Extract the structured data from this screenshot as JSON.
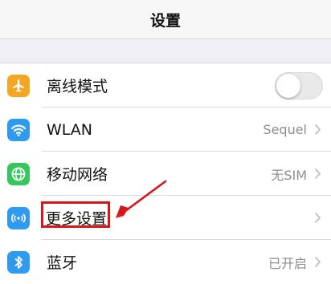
{
  "header": {
    "title": "设置"
  },
  "settings": {
    "airplane": {
      "label": "离线模式",
      "icon": "airplane-icon",
      "color": "#f5a623",
      "toggle": "off"
    },
    "wlan": {
      "label": "WLAN",
      "value": "Sequel",
      "icon": "wifi-icon",
      "color": "#2f9bf0"
    },
    "cellular": {
      "label": "移动网络",
      "value": "无SIM",
      "icon": "globe-icon",
      "color": "#34c759"
    },
    "more": {
      "label": "更多设置",
      "icon": "signal-icon",
      "color": "#2f9bf0"
    },
    "bluetooth": {
      "label": "蓝牙",
      "value": "已开启",
      "icon": "bluetooth-icon",
      "color": "#2f9bf0"
    }
  },
  "annotation": {
    "color": "#d7161b"
  }
}
